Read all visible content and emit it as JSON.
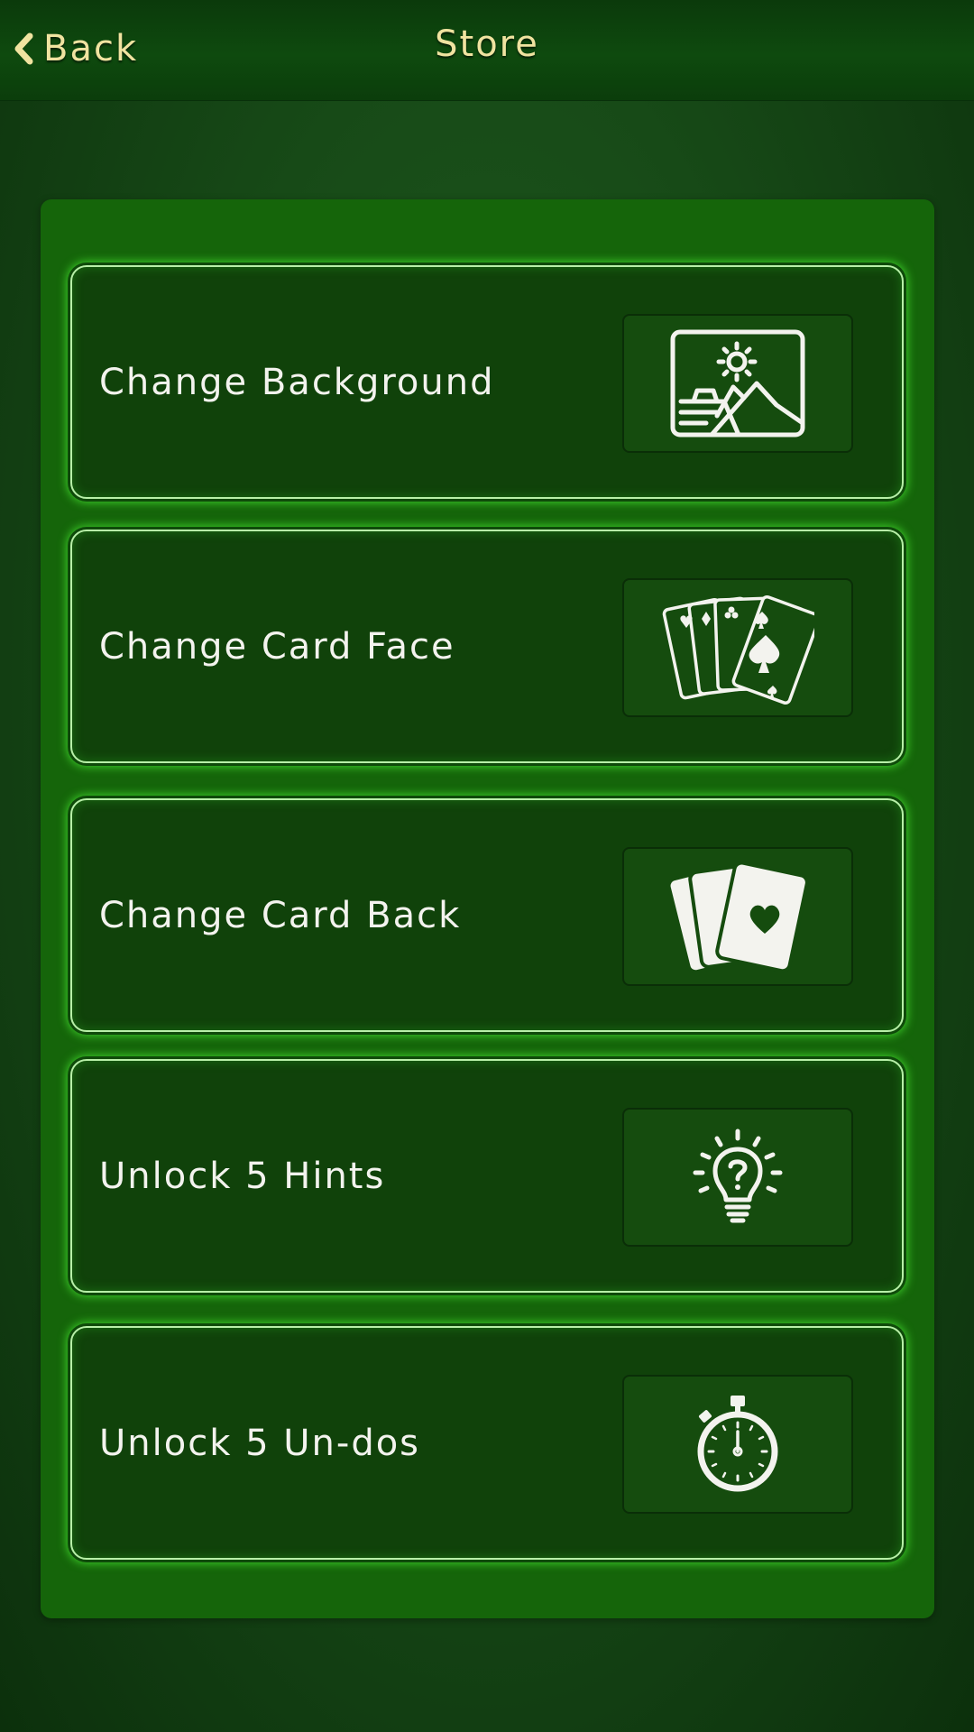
{
  "header": {
    "back_label": "Back",
    "title": "Store"
  },
  "store": {
    "items": [
      {
        "label": "Change Background",
        "icon": "landscape-image-icon"
      },
      {
        "label": "Change Card Face",
        "icon": "card-fan-icon"
      },
      {
        "label": "Change Card Back",
        "icon": "card-back-icon"
      },
      {
        "label": "Unlock 5 Hints",
        "icon": "lightbulb-hint-icon"
      },
      {
        "label": "Unlock 5 Un-dos",
        "icon": "stopwatch-icon"
      }
    ]
  },
  "colors": {
    "title_text": "#f0e3a0",
    "panel": "#15650a",
    "item_background": "#10420a",
    "item_glow": "#3ed02a",
    "icon_stroke": "#f3f3ee"
  }
}
